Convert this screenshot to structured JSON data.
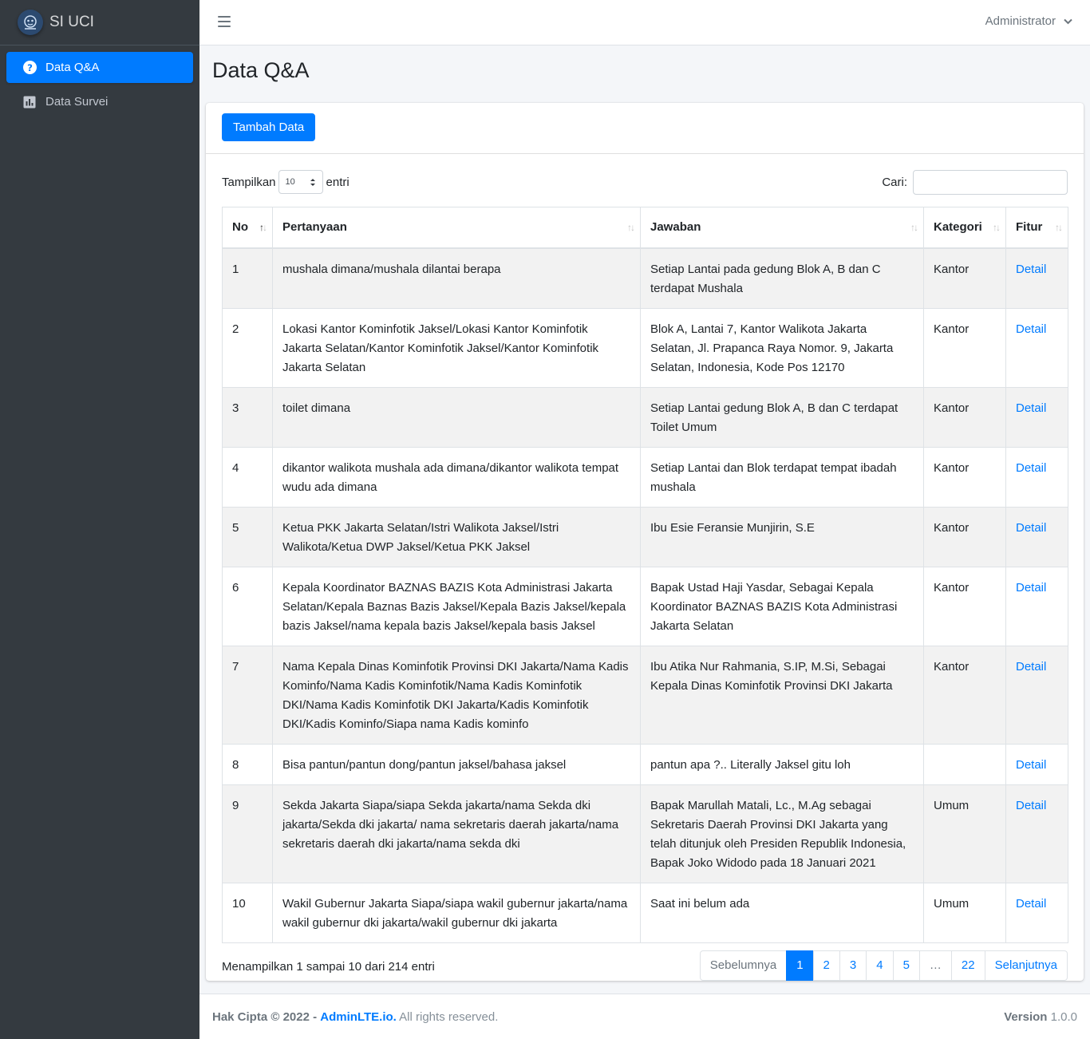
{
  "brand": {
    "name": "SI UCI"
  },
  "sidebar": {
    "items": [
      {
        "label": "Data Q&A",
        "icon": "question-circle-icon",
        "active": true
      },
      {
        "label": "Data Survei",
        "icon": "bar-chart-icon",
        "active": false
      }
    ]
  },
  "header": {
    "user": "Administrator"
  },
  "page": {
    "title": "Data Q&A"
  },
  "card": {
    "add_button": "Tambah Data"
  },
  "table_controls": {
    "show_label": "Tampilkan",
    "show_value": "10",
    "entries_label": "entri",
    "search_label": "Cari:",
    "search_value": ""
  },
  "table": {
    "columns": [
      "No",
      "Pertanyaan",
      "Jawaban",
      "Kategori",
      "Fitur"
    ],
    "rows": [
      {
        "no": "1",
        "q": "mushala dimana/mushala dilantai berapa",
        "a": "Setiap Lantai pada gedung Blok A, B dan C terdapat Mushala",
        "cat": "Kantor",
        "action": "Detail"
      },
      {
        "no": "2",
        "q": "Lokasi Kantor Kominfotik Jaksel/Lokasi Kantor Kominfotik Jakarta Selatan/Kantor Kominfotik Jaksel/Kantor Kominfotik Jakarta Selatan",
        "a": "Blok A, Lantai 7, Kantor Walikota Jakarta Selatan, Jl. Prapanca Raya Nomor. 9, Jakarta Selatan, Indonesia, Kode Pos 12170",
        "cat": "Kantor",
        "action": "Detail"
      },
      {
        "no": "3",
        "q": "toilet dimana",
        "a": "Setiap Lantai gedung Blok A, B dan C terdapat Toilet Umum",
        "cat": "Kantor",
        "action": "Detail"
      },
      {
        "no": "4",
        "q": "dikantor walikota mushala ada dimana/dikantor walikota tempat wudu ada dimana",
        "a": "Setiap Lantai dan Blok terdapat tempat ibadah mushala",
        "cat": "Kantor",
        "action": "Detail"
      },
      {
        "no": "5",
        "q": "Ketua PKK Jakarta Selatan/Istri Walikota Jaksel/Istri Walikota/Ketua DWP Jaksel/Ketua PKK Jaksel",
        "a": "Ibu Esie Feransie Munjirin, S.E",
        "cat": "Kantor",
        "action": "Detail"
      },
      {
        "no": "6",
        "q": "Kepala Koordinator BAZNAS BAZIS Kota Administrasi Jakarta Selatan/Kepala Baznas Bazis Jaksel/Kepala Bazis Jaksel/kepala bazis Jaksel/nama kepala bazis Jaksel/kepala basis Jaksel",
        "a": "Bapak Ustad Haji Yasdar, Sebagai Kepala Koordinator BAZNAS BAZIS Kota Administrasi Jakarta Selatan",
        "cat": "Kantor",
        "action": "Detail"
      },
      {
        "no": "7",
        "q": "Nama Kepala Dinas Kominfotik Provinsi DKI Jakarta/Nama Kadis Kominfo/Nama Kadis Kominfotik/Nama Kadis Kominfotik DKI/Nama Kadis Kominfotik DKI Jakarta/Kadis Kominfotik DKI/Kadis Kominfo/Siapa nama Kadis kominfo",
        "a": "Ibu Atika Nur Rahmania, S.IP, M.Si, Sebagai Kepala Dinas Kominfotik Provinsi DKI Jakarta",
        "cat": "Kantor",
        "action": "Detail"
      },
      {
        "no": "8",
        "q": "Bisa pantun/pantun dong/pantun jaksel/bahasa jaksel",
        "a": "pantun apa ?.. Literally Jaksel gitu loh",
        "cat": "",
        "action": "Detail"
      },
      {
        "no": "9",
        "q": "Sekda Jakarta Siapa/siapa Sekda jakarta/nama Sekda dki jakarta/Sekda dki jakarta/ nama sekretaris daerah jakarta/nama sekretaris daerah dki jakarta/nama sekda dki",
        "a": "Bapak Marullah Matali, Lc., M.Ag sebagai Sekretaris Daerah Provinsi DKI Jakarta yang telah ditunjuk oleh Presiden Republik Indonesia, Bapak Joko Widodo pada 18 Januari 2021",
        "cat": "Umum",
        "action": "Detail"
      },
      {
        "no": "10",
        "q": "Wakil Gubernur Jakarta Siapa/siapa wakil gubernur jakarta/nama wakil gubernur dki jakarta/wakil gubernur dki jakarta",
        "a": "Saat ini belum ada",
        "cat": "Umum",
        "action": "Detail"
      }
    ]
  },
  "info": "Menampilkan 1 sampai 10 dari 214 entri",
  "pagination": {
    "prev": "Sebelumnya",
    "pages": [
      "1",
      "2",
      "3",
      "4",
      "5",
      "…",
      "22"
    ],
    "active": "1",
    "next": "Selanjutnya"
  },
  "footer": {
    "copyright": "Hak Cipta © 2022 -",
    "brand_link": "AdminLTE.io.",
    "rights": "All rights reserved.",
    "version_label": "Version",
    "version": "1.0.0"
  }
}
